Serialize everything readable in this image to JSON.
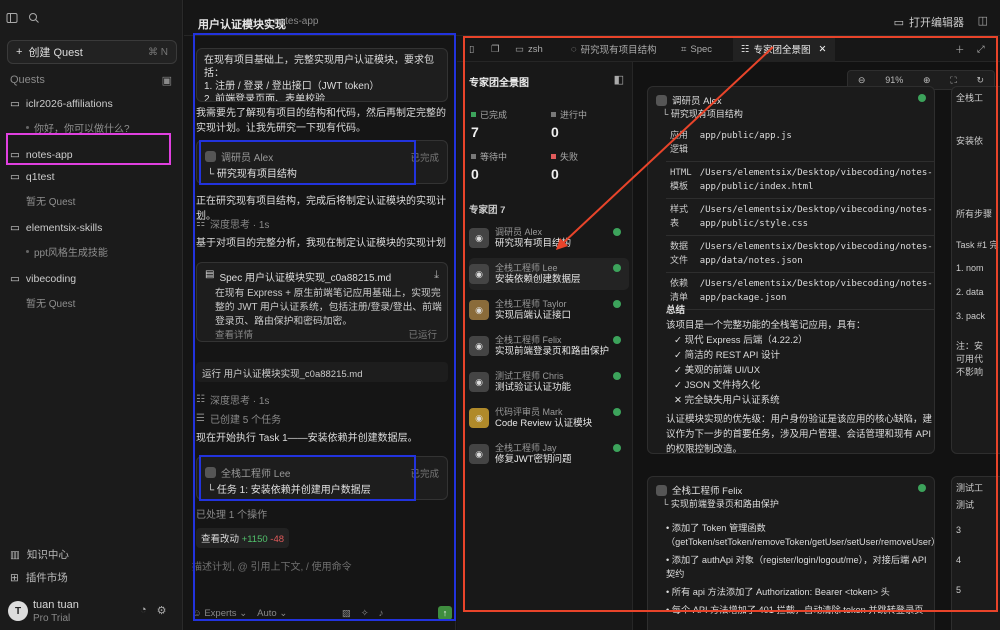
{
  "sidebar": {
    "new_quest": "创建 Quest",
    "new_quest_kbd": "⌘ N",
    "section": "Quests",
    "projects": [
      {
        "name": "iclr2026-affiliations",
        "sub": "你好，你可以做什么?"
      },
      {
        "name": "notes-app",
        "sub": ""
      },
      {
        "name": "q1test",
        "sub": "暂无 Quest"
      },
      {
        "name": "elementsix-skills",
        "sub": "ppt风格生成技能"
      },
      {
        "name": "vibecoding",
        "sub": "暂无 Quest"
      }
    ],
    "footer": {
      "knowledge": "知识中心",
      "plugins": "插件市场"
    },
    "user": {
      "initial": "T",
      "name": "tuan tuan",
      "plan": "Pro Trial"
    }
  },
  "topbar": {
    "title": "用户认证模块实现",
    "subtitle": "notes-app",
    "open_editor": "打开编辑器"
  },
  "chat": {
    "request": "在现有项目基础上，完整实现用户认证模块，要求包括：\n1. 注册 / 登录 / 登出接口（JWT token）\n2. 前端登录页面、表单校验",
    "p1": "我需要先了解现有项目的结构和代码，然后再制定完整的实现计划。让我先研究一下现有代码。",
    "agent1": {
      "role": "调研员 Alex",
      "task": "研究现有项目结构",
      "status": "已完成"
    },
    "p2": "正在研究现有项目结构，完成后将制定认证模块的实现计划。",
    "think1": "深度思考 · 1s",
    "p3": "基于对项目的完整分析，我现在制定认证模块的实现计划",
    "spec": {
      "title": "Spec  用户认证模块实现_c0a88215.md",
      "body": "在现有 Express + 原生前端笔记应用基础上，实现完整的 JWT 用户认证系统，包括注册/登录/登出、前端登录页、路由保护和密码加密。",
      "view": "查看详情",
      "ran": "已运行"
    },
    "run": "运行  用户认证模块实现_c0a88215.md",
    "think2": "深度思考 · 1s",
    "created": "已创建 5 个任务",
    "p4": "现在开始执行 Task 1——安装依赖并创建数据层。",
    "agent2": {
      "role": "全栈工程师 Lee",
      "task": "任务 1: 安装依赖并创建用户数据层",
      "status": "已完成"
    },
    "processed": "已处理 1 个操作",
    "diff": {
      "label": "查看改动",
      "plus": "+1150",
      "minus": "-48"
    },
    "placeholder": "描述计划, @ 引用上下文, / 使用命令",
    "mode": "Experts",
    "model": "Auto"
  },
  "tabs": [
    {
      "label": "zsh"
    },
    {
      "label": "研究现有项目结构"
    },
    {
      "label": "Spec"
    },
    {
      "label": "专家团全景图"
    }
  ],
  "expert_panel": {
    "title": "专家团全景图",
    "stats": [
      {
        "label": "已完成",
        "value": "7",
        "color": "#3ca35b"
      },
      {
        "label": "进行中",
        "value": "0",
        "color": "#666666"
      },
      {
        "label": "等待中",
        "value": "0",
        "color": "#666666"
      },
      {
        "label": "失败",
        "value": "0",
        "color": "#e05a5a"
      }
    ],
    "team_label": "专家团 7",
    "members": [
      {
        "role": "调研员 Alex",
        "task": "研究现有项目结构"
      },
      {
        "role": "全栈工程师 Lee",
        "task": "安装依赖创建数据层"
      },
      {
        "role": "全栈工程师 Taylor",
        "task": "实现后端认证接口"
      },
      {
        "role": "全栈工程师 Felix",
        "task": "实现前端登录页和路由保护"
      },
      {
        "role": "测试工程师 Chris",
        "task": "测试验证认证功能"
      },
      {
        "role": "代码评审员 Mark",
        "task": "Code Review 认证模块"
      },
      {
        "role": "全栈工程师 Jay",
        "task": "修复JWT密钥问题"
      }
    ]
  },
  "content": {
    "zoom": "91%",
    "alex_card": {
      "role": "调研员 Alex",
      "task": "研究现有项目结构",
      "rows": [
        {
          "k": "应用逻辑",
          "v": "app/public/app.js"
        },
        {
          "k": "HTML 模板",
          "v": "/Users/elementsix/Desktop/vibecoding/notes-app/public/index.html"
        },
        {
          "k": "样式表",
          "v": "/Users/elementsix/Desktop/vibecoding/notes-app/public/style.css"
        },
        {
          "k": "数据文件",
          "v": "/Users/elementsix/Desktop/vibecoding/notes-app/data/notes.json"
        },
        {
          "k": "依赖清单",
          "v": "/Users/elementsix/Desktop/vibecoding/notes-app/package.json"
        }
      ],
      "summary_title": "总结",
      "summary_intro": "该项目是一个完整功能的全栈笔记应用，具有：",
      "bullets": [
        "✓ 现代 Express 后端（4.22.2）",
        "✓ 简洁的 REST API 设计",
        "✓ 美观的前端 UI/UX",
        "✓ JSON 文件持久化",
        "✕ 完全缺失用户认证系统"
      ],
      "priority": "认证模块实现的优先级：用户身份验证是该应用的核心缺陷，建议作为下一步的首要任务，涉及用户管理、会话管理和现有 API 的权限控制改造。"
    },
    "felix_card": {
      "role": "全栈工程师 Felix",
      "task": "实现前端登录页和路由保护",
      "items": [
        "添加了 Token 管理函数（getToken/setToken/removeToken/getUser/setUser/removeUser）",
        "添加了 authApi 对象（register/login/logout/me），对接后端 API 契约",
        "所有 api 方法添加了 Authorization: Bearer <token> 头",
        "每个 API 方法增加了 401 拦截，自动清除 token 并跳转登录页"
      ]
    },
    "side_top": {
      "role": "全栈工",
      "lines": [
        "安装依",
        "所有步骤",
        "Task #1 完",
        "1. nom",
        "2. data",
        "3. pack",
        "注：安",
        "可用代",
        "不影响"
      ]
    },
    "side_bottom": {
      "role": "测试工",
      "lines": [
        "测试",
        "3",
        "4",
        "5"
      ]
    }
  },
  "colors": {
    "highlight_blue": "#2233dd",
    "highlight_red": "#e8442a",
    "highlight_magenta": "#e040e0"
  }
}
